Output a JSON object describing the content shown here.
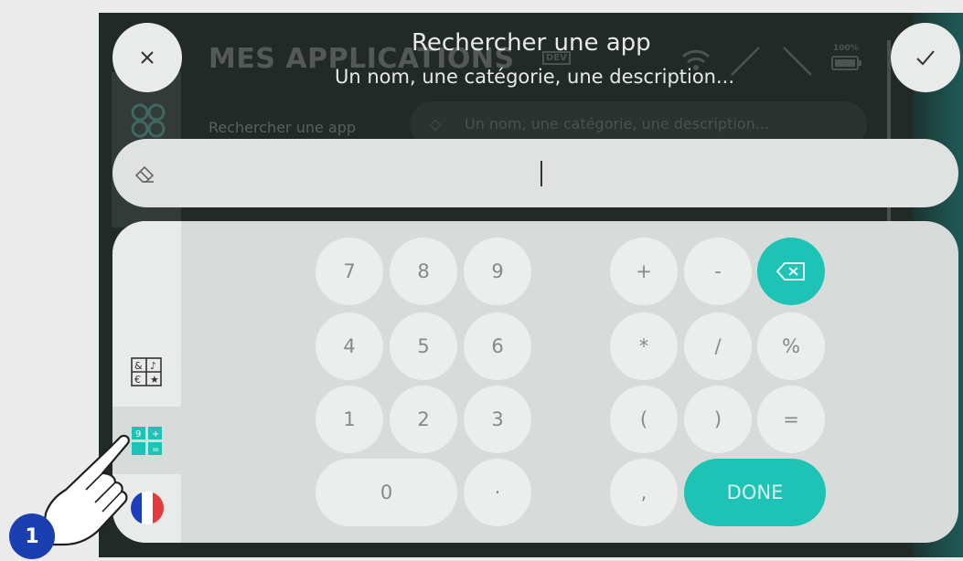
{
  "background_app": {
    "header": "MES APPLICATIONS",
    "search_label": "Rechercher une app",
    "search_placeholder": "Un nom, une catégorie, une description...",
    "dev_badge": "DEV",
    "battery": "100%"
  },
  "overlay": {
    "title": "Rechercher une app",
    "subtitle": "Un nom, une catégorie, une description..."
  },
  "keyboard": {
    "rows": [
      [
        "7",
        "8",
        "9",
        "+",
        "-"
      ],
      [
        "4",
        "5",
        "6",
        "*",
        "/",
        "%"
      ],
      [
        "1",
        "2",
        "3",
        "(",
        ")",
        "="
      ],
      [
        "0",
        "·",
        ","
      ]
    ],
    "done_label": "DONE"
  },
  "tutorial": {
    "step": "1"
  },
  "colors": {
    "accent": "#1ec3b6",
    "badge": "#1a3fb0"
  }
}
